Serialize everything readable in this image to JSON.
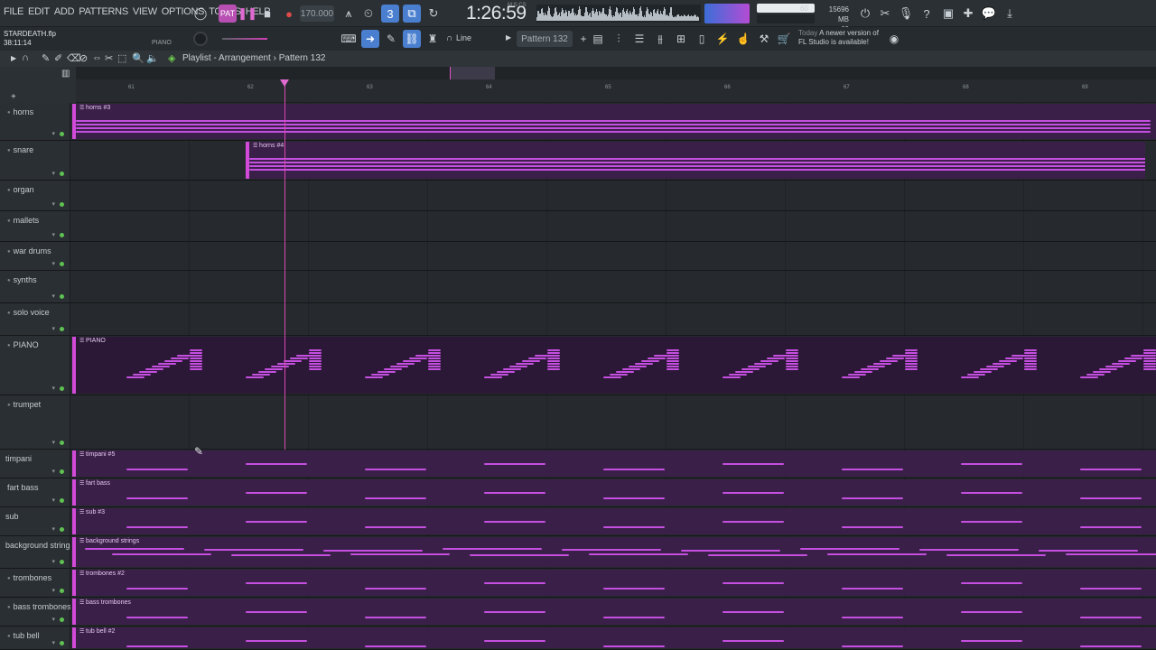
{
  "menu": [
    "FILE",
    "EDIT",
    "ADD",
    "PATTERNS",
    "VIEW",
    "OPTIONS",
    "TOOLS",
    "HELP"
  ],
  "transport": {
    "tempo": "170.000",
    "time": "1:26:59",
    "time_unit": "M:S:CS",
    "pattern_mode": "PAT",
    "record_mode": "REC"
  },
  "monitor": {
    "cpu": "60",
    "memory": "15696 MB",
    "polyphony": "60"
  },
  "project": {
    "filename": "STARDEATH.flp",
    "duration": "38:11:14",
    "channel_label": "PIANO"
  },
  "toolbar2": {
    "snap": "Line",
    "pattern": "Pattern 132"
  },
  "news": {
    "label": "Today",
    "text": "A newer version of FL Studio is available!"
  },
  "playlist": {
    "breadcrumb_window": "Playlist",
    "breadcrumb_sep": " - ",
    "breadcrumb_view": "Arrangement",
    "breadcrumb_sep2": " › ",
    "breadcrumb_pattern": "Pattern 132"
  },
  "ruler_ticks": [
    "61",
    "62",
    "63",
    "64",
    "65",
    "66",
    "67",
    "68",
    "69"
  ],
  "tracks": [
    {
      "name": "horns",
      "clip": "horns #3"
    },
    {
      "name": "snare",
      "clip": "horns #4"
    },
    {
      "name": "organ",
      "clip": ""
    },
    {
      "name": "mallets",
      "clip": ""
    },
    {
      "name": "war drums",
      "clip": ""
    },
    {
      "name": "synths",
      "clip": ""
    },
    {
      "name": "solo voice",
      "clip": ""
    },
    {
      "name": "PIANO",
      "clip": "PIANO"
    },
    {
      "name": "trumpet",
      "clip": ""
    },
    {
      "name": "timpani",
      "clip": "timpani #5"
    },
    {
      "name": "fart bass",
      "clip": "fart bass"
    },
    {
      "name": "sub",
      "clip": "sub #3"
    },
    {
      "name": "background strings",
      "clip": "background strings"
    },
    {
      "name": "trombones",
      "clip": "trombones #2"
    },
    {
      "name": "bass trombones",
      "clip": "bass trombones"
    },
    {
      "name": "tub bell",
      "clip": "tub bell #2"
    }
  ],
  "colors": {
    "accent": "#d24ad8",
    "clip_bg": "#3a1f48",
    "playhead": "#d84ab0",
    "active_button": "#4a7fd0"
  }
}
